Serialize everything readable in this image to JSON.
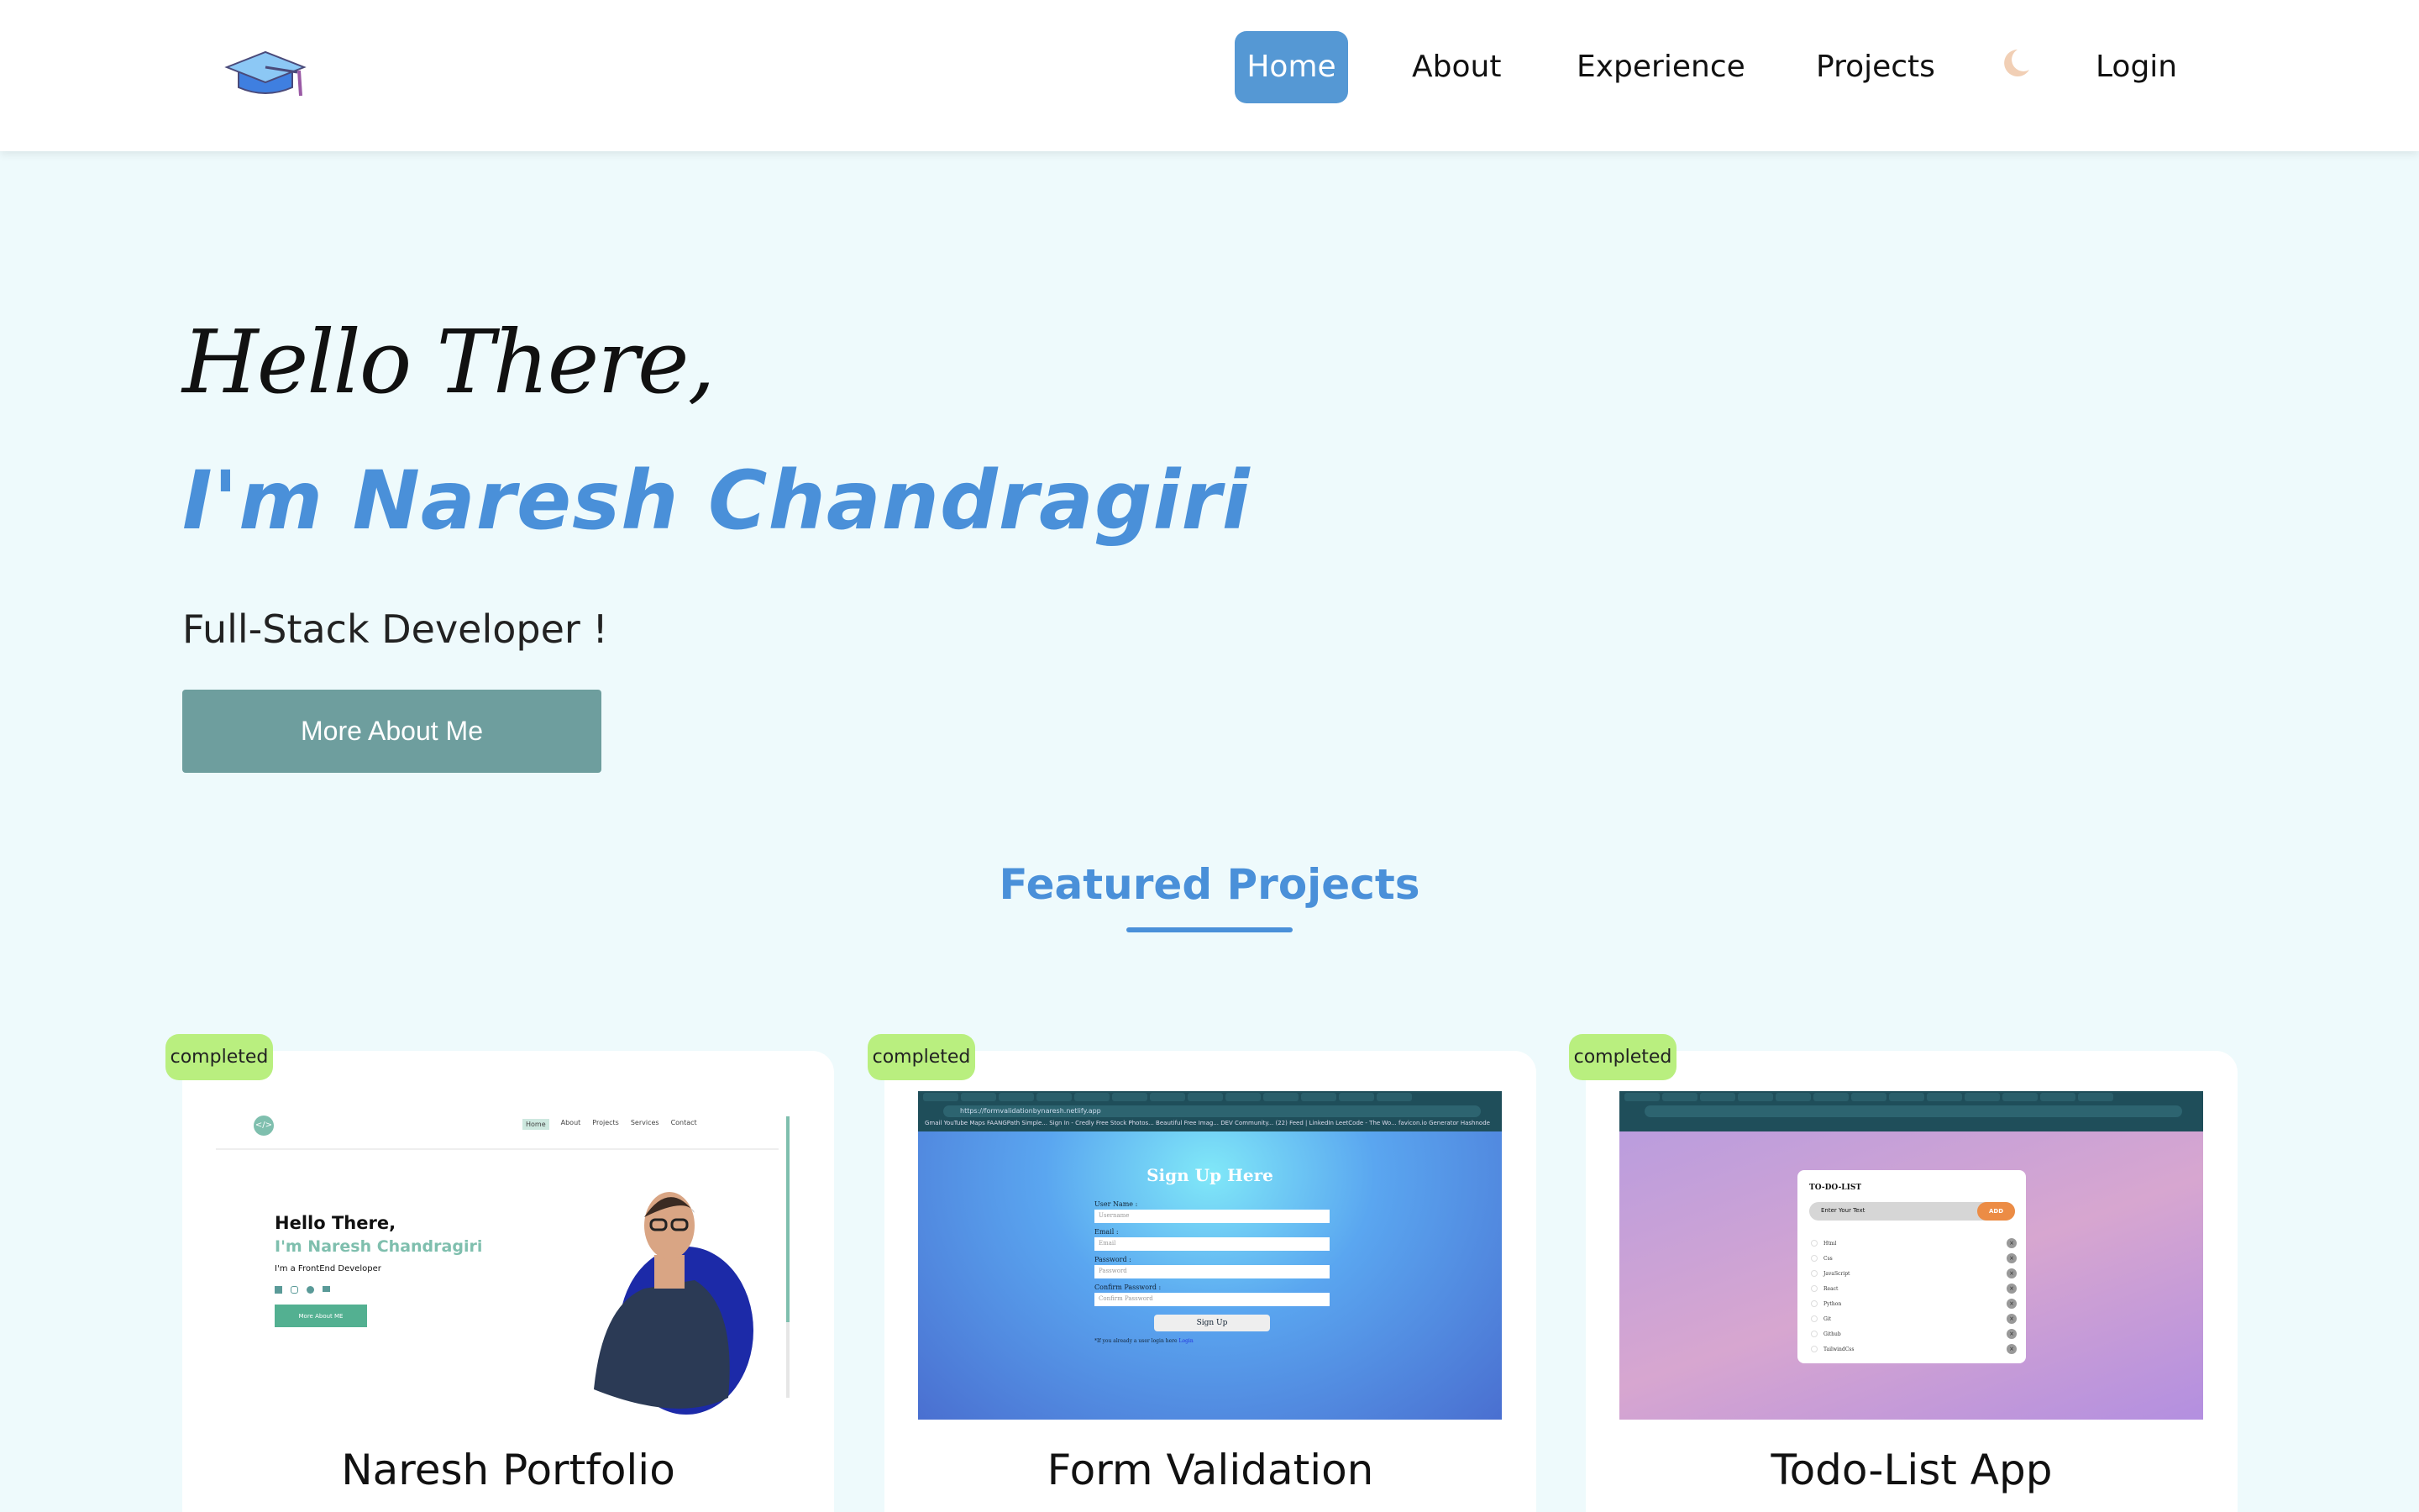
{
  "header": {
    "nav": [
      "Home",
      "About",
      "Experience",
      "Projects",
      "Login"
    ],
    "active": "Home",
    "accent": "#5598d4"
  },
  "hero": {
    "greeting": "Hello There,",
    "name": "I'm Naresh Chandragiri",
    "role": "Full-Stack Developer !",
    "button": "More About Me"
  },
  "featured": {
    "title": "Featured Projects"
  },
  "projects": [
    {
      "status": "completed",
      "title": "Naresh Portfolio",
      "preview": {
        "nav": [
          "Home",
          "About",
          "Projects",
          "Services",
          "Contact"
        ],
        "greeting": "Hello There,",
        "name": "I'm Naresh Chandragiri",
        "role": "I'm a FrontEnd Developer",
        "button": "More About ME"
      }
    },
    {
      "status": "completed",
      "title": "Form Validation",
      "preview": {
        "url": "https://formvalidationbynaresh.netlify.app",
        "bookmarks": "Gmail  YouTube  Maps  FAANGPath Simple...  Sign In - Credly  Free Stock Photos...  Beautiful Free Imag...  DEV Community...  (22) Feed | LinkedIn  LeetCode - The Wo...  favicon.io Generator  Hashnode",
        "heading": "Sign Up Here",
        "fields": [
          {
            "label": "User Name :",
            "placeholder": "Username"
          },
          {
            "label": "Email :",
            "placeholder": "Email"
          },
          {
            "label": "Password :",
            "placeholder": "Password"
          },
          {
            "label": "Confirm Password :",
            "placeholder": "Confirm Password"
          }
        ],
        "submit": "Sign Up",
        "note": "*If you already a user login here",
        "link": "Login"
      }
    },
    {
      "status": "completed",
      "title": "Todo-List App",
      "preview": {
        "heading": "TO-DO-LIST",
        "placeholder": "Enter Your Text",
        "add": "ADD",
        "items": [
          "Html",
          "Css",
          "JavaScript",
          "React",
          "Python",
          "Git",
          "Github",
          "TailwindCss"
        ]
      }
    }
  ]
}
